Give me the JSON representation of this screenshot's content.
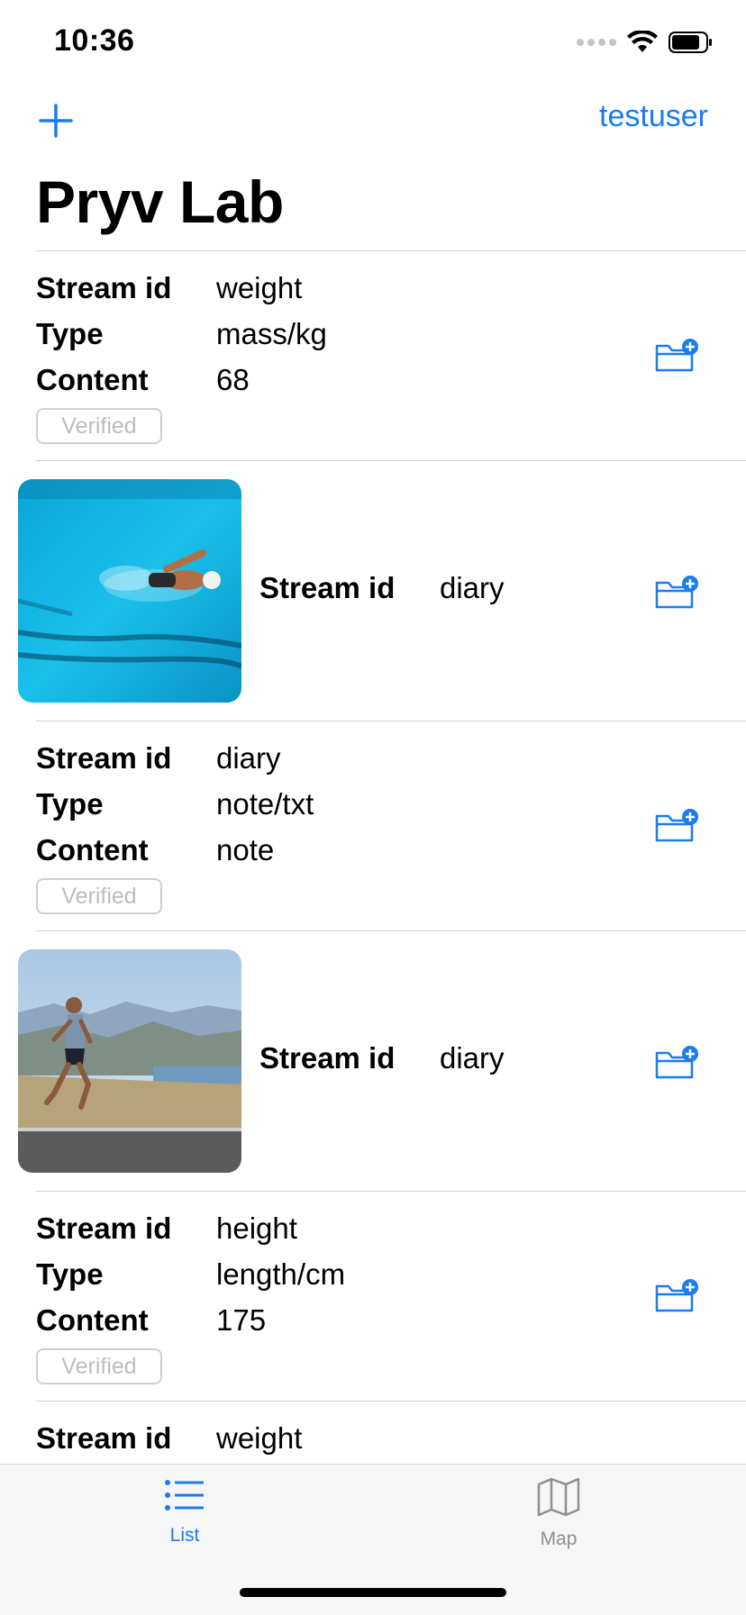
{
  "status": {
    "time": "10:36"
  },
  "nav": {
    "user": "testuser",
    "title": "Pryv Lab"
  },
  "labels": {
    "stream_id": "Stream id",
    "type": "Type",
    "content": "Content",
    "verified": "Verified"
  },
  "events": [
    {
      "kind": "text",
      "stream_id": "weight",
      "type": "mass/kg",
      "content": "68",
      "verified": true
    },
    {
      "kind": "image",
      "stream_id": "diary",
      "image": "swimmer-photo"
    },
    {
      "kind": "text",
      "stream_id": "diary",
      "type": "note/txt",
      "content": "note",
      "verified": true
    },
    {
      "kind": "image",
      "stream_id": "diary",
      "image": "runner-photo"
    },
    {
      "kind": "text",
      "stream_id": "height",
      "type": "length/cm",
      "content": "175",
      "verified": true
    },
    {
      "kind": "text",
      "stream_id": "weight"
    }
  ],
  "tabs": [
    {
      "label": "List",
      "icon": "list-icon",
      "active": true
    },
    {
      "label": "Map",
      "icon": "map-icon",
      "active": false
    }
  ],
  "colors": {
    "accent": "#1a7cf0",
    "separator": "#cfcfcf",
    "verified_text": "#bdbdbd",
    "tab_inactive": "#8e8e93"
  }
}
